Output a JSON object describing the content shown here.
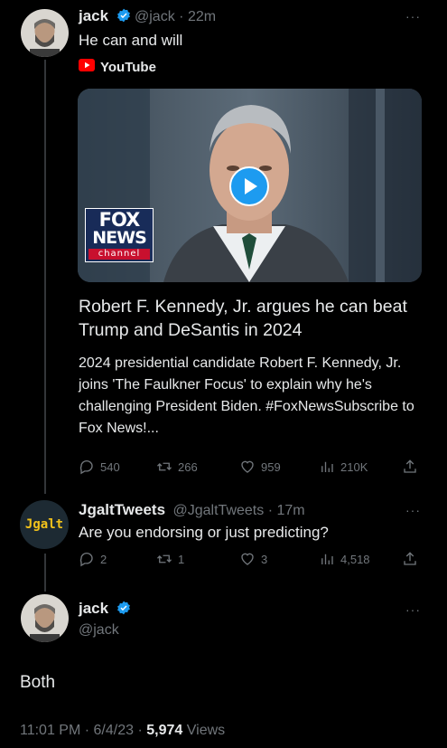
{
  "main_tweet": {
    "author_name": "jack",
    "author_handle": "@jack",
    "time": "22m",
    "separator": "·",
    "text": "He can and will",
    "source_label": "YouTube",
    "card": {
      "logo_line1": "FOX",
      "logo_line2": "NEWS",
      "logo_line3": "channel",
      "title": "Robert F. Kennedy, Jr. argues he can beat Trump and DeSantis in 2024",
      "description": "2024 presidential candidate Robert F. Kennedy, Jr. joins 'The Faulkner Focus' to explain why he's challenging President Biden. #FoxNewsSubscribe to Fox News!..."
    },
    "stats": {
      "replies": "540",
      "reposts": "266",
      "likes": "959",
      "views": "210K"
    }
  },
  "reply_tweet": {
    "author_name": "JgaltTweets",
    "author_handle": "@JgaltTweets",
    "time": "17m",
    "separator": "·",
    "avatar_text": "Jgalt",
    "text": "Are you endorsing or just predicting?",
    "stats": {
      "replies": "2",
      "reposts": "1",
      "likes": "3",
      "views": "4,518"
    }
  },
  "focused_tweet": {
    "author_name": "jack",
    "author_handle": "@jack",
    "text": "Both",
    "time": "11:01 PM",
    "date": "6/4/23",
    "separator": "·",
    "views_count": "5,974",
    "views_label": "Views"
  },
  "colors": {
    "background": "#000000",
    "text": "#e7e9ea",
    "muted": "#71767b",
    "verified_blue": "#1d9bf0",
    "youtube_red": "#ff0000",
    "jgalt_yellow": "#f2c21b",
    "play_blue": "#1d9bf0"
  },
  "icons": [
    "verified-badge-icon",
    "youtube-icon",
    "play-icon",
    "reply-icon",
    "repost-icon",
    "like-icon",
    "views-icon",
    "share-icon",
    "more-icon"
  ]
}
